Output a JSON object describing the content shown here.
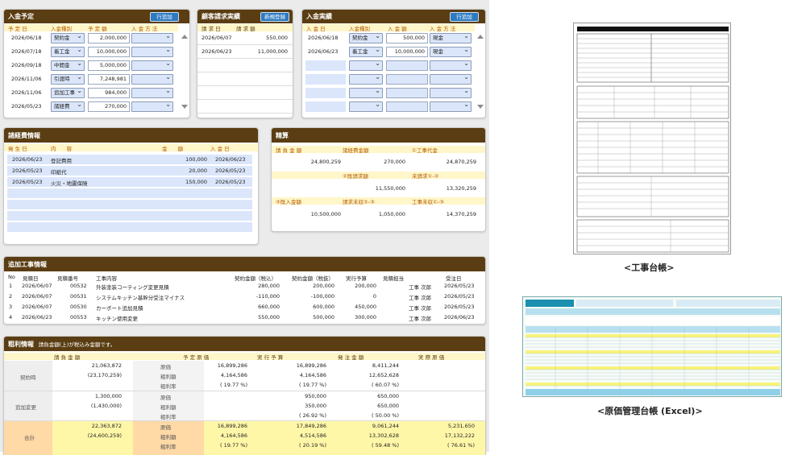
{
  "nyukin_yotei": {
    "title": "入金予定",
    "add_btn": "行追加",
    "cols": [
      "予 定 日",
      "入金種別",
      "予 定 額",
      "入 金 方 法"
    ],
    "rows": [
      {
        "date": "2026/06/18",
        "type": "契約金",
        "amount": "2,000,000"
      },
      {
        "date": "2026/07/18",
        "type": "着工金",
        "amount": "10,000,000"
      },
      {
        "date": "2026/09/18",
        "type": "中間金",
        "amount": "5,000,000"
      },
      {
        "date": "2026/11/06",
        "type": "引渡時",
        "amount": "7,248,981"
      },
      {
        "date": "2026/11/06",
        "type": "追加工事",
        "amount": "984,000"
      },
      {
        "date": "2026/05/23",
        "type": "諸経費",
        "amount": "270,000"
      }
    ]
  },
  "kokyaku": {
    "title": "顧客請求実績",
    "add_btn": "新規登録",
    "cols": [
      "請 求 日",
      "請 求 額"
    ],
    "rows": [
      {
        "date": "2026/06/07",
        "amount": "550,000"
      },
      {
        "date": "2026/06/23",
        "amount": "11,000,000"
      }
    ]
  },
  "nyukin_jisseki": {
    "title": "入金実績",
    "add_btn": "行追加",
    "cols": [
      "入 金 日",
      "入金種別",
      "入 金 額",
      "入 金 方 法"
    ],
    "rows": [
      {
        "date": "2026/06/18",
        "type": "契約金",
        "amount": "500,000",
        "method": "現金"
      },
      {
        "date": "2026/06/23",
        "type": "着工金",
        "amount": "10,000,000",
        "method": "現金"
      }
    ]
  },
  "shokeihi": {
    "title": "諸経費情報",
    "cols": [
      "発 生 日",
      "内　　容",
      "金　　額",
      "入 金 日"
    ],
    "rows": [
      {
        "date": "2026/06/23",
        "desc": "登記費用",
        "amount": "100,000",
        "paid": "2026/06/23"
      },
      {
        "date": "2026/05/23",
        "desc": "印紙代",
        "amount": "20,000",
        "paid": "2026/05/23"
      },
      {
        "date": "2026/05/23",
        "desc": "火災・地震保険",
        "amount": "150,000",
        "paid": "2026/05/23"
      }
    ]
  },
  "seisan": {
    "title": "精算",
    "row1_labels": [
      "請 負 金 額",
      "諸経費金額",
      "①工事代金"
    ],
    "row1_values": [
      "24,800,259",
      "270,000",
      "24,870,259"
    ],
    "row2_labels": [
      "②既請求額",
      "未請求①-②"
    ],
    "row2_values": [
      "11,550,000",
      "13,320,259"
    ],
    "row3_labels": [
      "③既入金額",
      "請求未収②-③",
      "工事未収①-③"
    ],
    "row3_values": [
      "10,500,000",
      "1,050,000",
      "14,370,259"
    ]
  },
  "tsuika": {
    "title": "追加工事情報",
    "cols": [
      "No",
      "見積日",
      "見積番号",
      "工事内容",
      "契約金額（税込）",
      "契約金額（税抜）",
      "実行予算",
      "見積担当",
      "受注日"
    ],
    "rows": [
      {
        "no": "1",
        "date": "2026/06/07",
        "num": "00532",
        "desc": "外装塗装コーティング変更見積",
        "tax_in": "280,000",
        "tax_out": "200,000",
        "budget": "200,000",
        "person": "工事 次郎",
        "order": "2026/05/23"
      },
      {
        "no": "2",
        "date": "2026/06/07",
        "num": "00531",
        "desc": "システムキッチン基幹分受注マイナス",
        "tax_in": "-110,000",
        "tax_out": "-100,000",
        "budget": "0",
        "person": "工事 次郎",
        "order": "2026/05/23"
      },
      {
        "no": "3",
        "date": "2026/06/07",
        "num": "00530",
        "desc": "カーポート追加見積",
        "tax_in": "660,000",
        "tax_out": "600,000",
        "budget": "450,000",
        "person": "工事 次郎",
        "order": "2026/05/23"
      },
      {
        "no": "4",
        "date": "2026/06/23",
        "num": "00553",
        "desc": "キッチン使用変更",
        "tax_in": "550,000",
        "tax_out": "500,000",
        "budget": "300,000",
        "person": "工事 次郎",
        "order": "2026/06/23"
      }
    ]
  },
  "arari": {
    "title": "粗利情報",
    "note": "請負金額(上)が税込み金額です。",
    "cols": [
      "請 負 金 額",
      "予 定 原 価",
      "実 行 予 算",
      "発 注 金 額",
      "実 際 原 価"
    ],
    "row_labels": [
      "契約時",
      "追加変更",
      "合計"
    ],
    "sub_labels": [
      "原価",
      "粗利額",
      "粗利率"
    ],
    "contract": {
      "amt": "21,063,872",
      "amt_tax": "(23,170,259)",
      "plan": [
        "16,899,286",
        "4,164,586",
        "( 19.77 %)"
      ],
      "exec": [
        "16,899,286",
        "4,164,586",
        "( 19.77 %)"
      ],
      "order": [
        "8,411,244",
        "12,652,628",
        "( 60.07 %)"
      ]
    },
    "change": {
      "amt": "1,300,000",
      "amt_tax": "(1,430,000)",
      "exec": [
        "950,000",
        "350,000",
        "( 26.92 %)"
      ],
      "order": [
        "650,000",
        "650,000",
        "( 50.00 %)"
      ]
    },
    "total": {
      "amt": "22,363,872",
      "amt_tax": "(24,600,259)",
      "plan": [
        "16,899,286",
        "4,164,586",
        "( 19.77 %)"
      ],
      "exec": [
        "17,849,286",
        "4,514,586",
        "( 20.19 %)"
      ],
      "order": [
        "9,061,244",
        "13,302,628",
        "( 59.48 %)"
      ],
      "actual": [
        "5,231,650",
        "17,132,222",
        "( 76.61 %)"
      ]
    }
  },
  "thumbs": {
    "caption1": "<工事台帳>",
    "caption2": "<原価管理台帳 (Excel)>"
  }
}
